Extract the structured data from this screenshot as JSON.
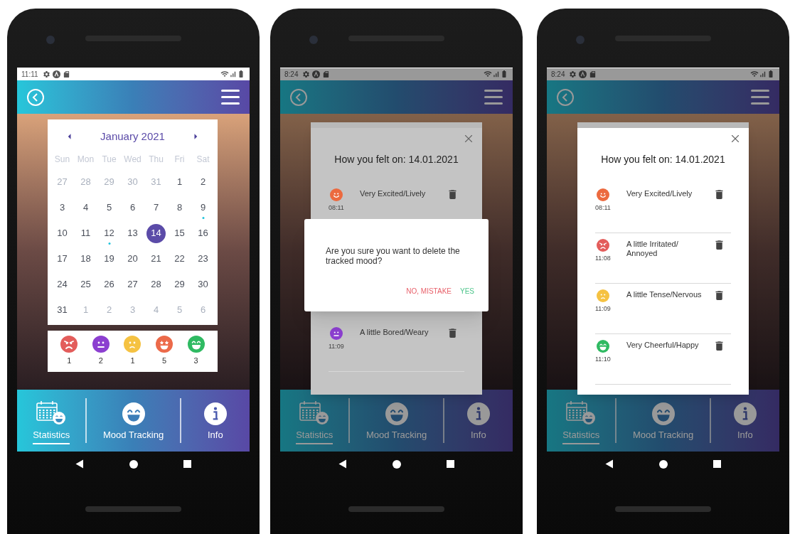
{
  "phones": [
    {
      "status_time": "11:11",
      "calendar": {
        "month": "January 2021",
        "weekdays": [
          "Sun",
          "Mon",
          "Tue",
          "Wed",
          "Thu",
          "Fri",
          "Sat"
        ],
        "weeks": [
          [
            {
              "day": "27",
              "in_month": false,
              "selected": false,
              "dot": false
            },
            {
              "day": "28",
              "in_month": false,
              "selected": false,
              "dot": false
            },
            {
              "day": "29",
              "in_month": false,
              "selected": false,
              "dot": false
            },
            {
              "day": "30",
              "in_month": false,
              "selected": false,
              "dot": false
            },
            {
              "day": "31",
              "in_month": false,
              "selected": false,
              "dot": false
            },
            {
              "day": "1",
              "in_month": true,
              "selected": false,
              "dot": false
            },
            {
              "day": "2",
              "in_month": true,
              "selected": false,
              "dot": false
            }
          ],
          [
            {
              "day": "3",
              "in_month": true,
              "selected": false,
              "dot": false
            },
            {
              "day": "4",
              "in_month": true,
              "selected": false,
              "dot": false
            },
            {
              "day": "5",
              "in_month": true,
              "selected": false,
              "dot": false
            },
            {
              "day": "6",
              "in_month": true,
              "selected": false,
              "dot": false
            },
            {
              "day": "7",
              "in_month": true,
              "selected": false,
              "dot": false
            },
            {
              "day": "8",
              "in_month": true,
              "selected": false,
              "dot": false
            },
            {
              "day": "9",
              "in_month": true,
              "selected": false,
              "dot": true
            }
          ],
          [
            {
              "day": "10",
              "in_month": true,
              "selected": false,
              "dot": false
            },
            {
              "day": "11",
              "in_month": true,
              "selected": false,
              "dot": false
            },
            {
              "day": "12",
              "in_month": true,
              "selected": false,
              "dot": true
            },
            {
              "day": "13",
              "in_month": true,
              "selected": false,
              "dot": false
            },
            {
              "day": "14",
              "in_month": true,
              "selected": true,
              "dot": false
            },
            {
              "day": "15",
              "in_month": true,
              "selected": false,
              "dot": false
            },
            {
              "day": "16",
              "in_month": true,
              "selected": false,
              "dot": false
            }
          ],
          [
            {
              "day": "17",
              "in_month": true,
              "selected": false,
              "dot": false
            },
            {
              "day": "18",
              "in_month": true,
              "selected": false,
              "dot": false
            },
            {
              "day": "19",
              "in_month": true,
              "selected": false,
              "dot": false
            },
            {
              "day": "20",
              "in_month": true,
              "selected": false,
              "dot": false
            },
            {
              "day": "21",
              "in_month": true,
              "selected": false,
              "dot": false
            },
            {
              "day": "22",
              "in_month": true,
              "selected": false,
              "dot": false
            },
            {
              "day": "23",
              "in_month": true,
              "selected": false,
              "dot": false
            }
          ],
          [
            {
              "day": "24",
              "in_month": true,
              "selected": false,
              "dot": false
            },
            {
              "day": "25",
              "in_month": true,
              "selected": false,
              "dot": false
            },
            {
              "day": "26",
              "in_month": true,
              "selected": false,
              "dot": false
            },
            {
              "day": "27",
              "in_month": true,
              "selected": false,
              "dot": false
            },
            {
              "day": "28",
              "in_month": true,
              "selected": false,
              "dot": false
            },
            {
              "day": "29",
              "in_month": true,
              "selected": false,
              "dot": false
            },
            {
              "day": "30",
              "in_month": true,
              "selected": false,
              "dot": false
            }
          ],
          [
            {
              "day": "31",
              "in_month": true,
              "selected": false,
              "dot": false
            },
            {
              "day": "1",
              "in_month": false,
              "selected": false,
              "dot": false
            },
            {
              "day": "2",
              "in_month": false,
              "selected": false,
              "dot": false
            },
            {
              "day": "3",
              "in_month": false,
              "selected": false,
              "dot": false
            },
            {
              "day": "4",
              "in_month": false,
              "selected": false,
              "dot": false
            },
            {
              "day": "5",
              "in_month": false,
              "selected": false,
              "dot": false
            },
            {
              "day": "6",
              "in_month": false,
              "selected": false,
              "dot": false
            }
          ]
        ]
      },
      "mood_counts": [
        {
          "kind": "angry",
          "color": "#e35d5b",
          "count": "1"
        },
        {
          "kind": "neutral",
          "color": "#8c3fd0",
          "count": "2"
        },
        {
          "kind": "worried",
          "color": "#f5c242",
          "count": "1"
        },
        {
          "kind": "star",
          "color": "#ec6a4a",
          "count": "5"
        },
        {
          "kind": "grin",
          "color": "#2fba62",
          "count": "3"
        }
      ],
      "nav": [
        {
          "label": "Statistics",
          "kind": "calendar",
          "selected": true
        },
        {
          "label": "Mood Tracking",
          "kind": "grin",
          "selected": false
        },
        {
          "label": "Info",
          "kind": "info",
          "selected": false
        }
      ]
    },
    {
      "status_time": "8:24",
      "popup": {
        "title": "How you felt on: 14.01.2021",
        "entries": [
          {
            "kind": "smile",
            "color": "#ec6a3f",
            "mood": "Very Excited/Lively",
            "time": "08:11"
          },
          {
            "kind": "neutral",
            "color": "#8c3fd0",
            "mood": "A little Bored/Weary",
            "time": "11:09"
          }
        ]
      },
      "confirm": {
        "message": "Are you sure you want to delete the tracked mood?",
        "buttons": [
          {
            "label": "NO, MISTAKE",
            "color": "#e8606a"
          },
          {
            "label": "YES",
            "color": "#4cc48a"
          }
        ]
      },
      "nav": [
        {
          "label": "Statistics",
          "kind": "calendar",
          "selected": true
        },
        {
          "label": "Mood Tracking",
          "kind": "grin",
          "selected": false
        },
        {
          "label": "Info",
          "kind": "info",
          "selected": false
        }
      ]
    },
    {
      "status_time": "8:24",
      "popup": {
        "title": "How you felt on: 14.01.2021",
        "entries": [
          {
            "kind": "smile",
            "color": "#ec6a3f",
            "mood": "Very Excited/Lively",
            "time": "08:11"
          },
          {
            "kind": "angry",
            "color": "#e35d5b",
            "mood": "A little Irritated/ Annoyed",
            "time": "11:08"
          },
          {
            "kind": "worried",
            "color": "#f5c242",
            "mood": "A little Tense/Nervous",
            "time": "11:09"
          },
          {
            "kind": "grin",
            "color": "#2fba62",
            "mood": "Very Cheerful/Happy",
            "time": "11:10"
          }
        ]
      },
      "nav": [
        {
          "label": "Statistics",
          "kind": "calendar",
          "selected": true
        },
        {
          "label": "Mood Tracking",
          "kind": "grin",
          "selected": false
        },
        {
          "label": "Info",
          "kind": "info",
          "selected": false
        }
      ]
    }
  ]
}
